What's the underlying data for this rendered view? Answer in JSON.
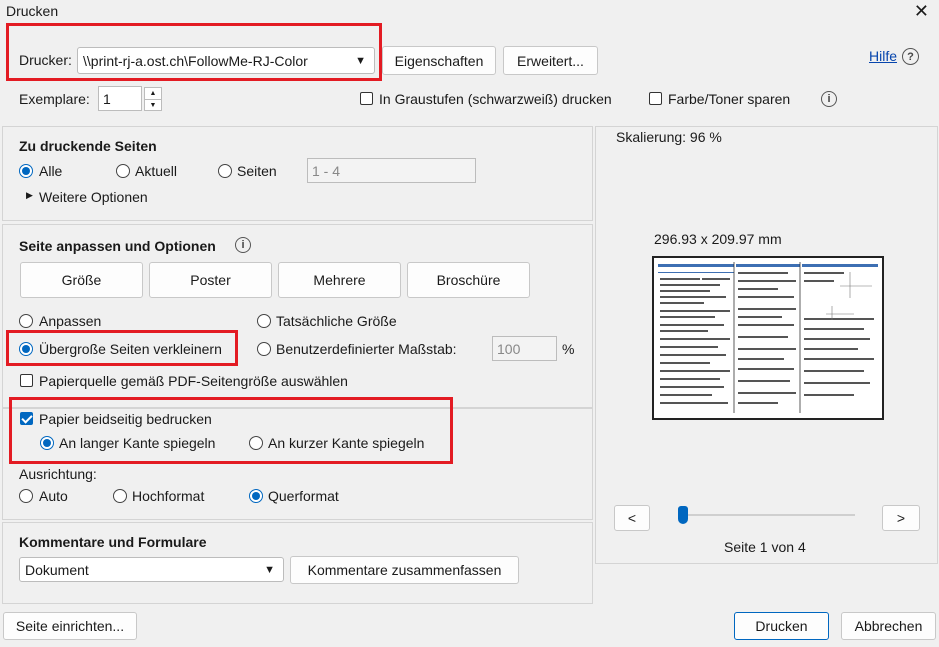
{
  "window": {
    "title": "Drucken",
    "help": "Hilfe"
  },
  "printer": {
    "label": "Drucker:",
    "value": "\\\\print-rj-a.ost.ch\\FollowMe-RJ-Color",
    "properties_button": "Eigenschaften",
    "advanced_button": "Erweitert..."
  },
  "copies": {
    "label": "Exemplare:",
    "value": "1"
  },
  "grayscale": {
    "label": "In Graustufen (schwarzweiß) drucken",
    "checked": false
  },
  "save_ink": {
    "label": "Farbe/Toner sparen",
    "checked": false
  },
  "pages": {
    "heading": "Zu druckende Seiten",
    "all": "Alle",
    "current": "Aktuell",
    "pages": "Seiten",
    "pages_placeholder": "1 - 4",
    "more_options": "Weitere Optionen",
    "selected": "all"
  },
  "fit": {
    "heading": "Seite anpassen und Optionen",
    "tabs": [
      "Größe",
      "Poster",
      "Mehrere",
      "Broschüre"
    ],
    "fit_label": "Anpassen",
    "actual_label": "Tatsächliche Größe",
    "shrink_label": "Übergroße Seiten verkleinern",
    "custom_label": "Benutzerdefinierter Maßstab:",
    "custom_value": "100",
    "percent": "%",
    "paper_source_label": "Papierquelle gemäß PDF-Seitengröße auswählen",
    "selected": "shrink"
  },
  "duplex": {
    "label": "Papier beidseitig bedrucken",
    "checked": true,
    "long_edge": "An langer Kante spiegeln",
    "short_edge": "An kurzer Kante spiegeln",
    "selected": "long"
  },
  "orientation": {
    "label": "Ausrichtung:",
    "auto": "Auto",
    "portrait": "Hochformat",
    "landscape": "Querformat",
    "selected": "landscape"
  },
  "comments": {
    "heading": "Kommentare und Formulare",
    "value": "Dokument",
    "summarize_button": "Kommentare zusammenfassen"
  },
  "preview": {
    "scaling": "Skalierung:  96 %",
    "dimensions": "296.93 x 209.97 mm",
    "prev": "<",
    "next": ">",
    "page_status": "Seite 1 von 4"
  },
  "footer": {
    "page_setup": "Seite einrichten...",
    "print": "Drucken",
    "cancel": "Abbrechen"
  },
  "colors": {
    "accent": "#0067c0",
    "highlight": "#e31b23"
  }
}
